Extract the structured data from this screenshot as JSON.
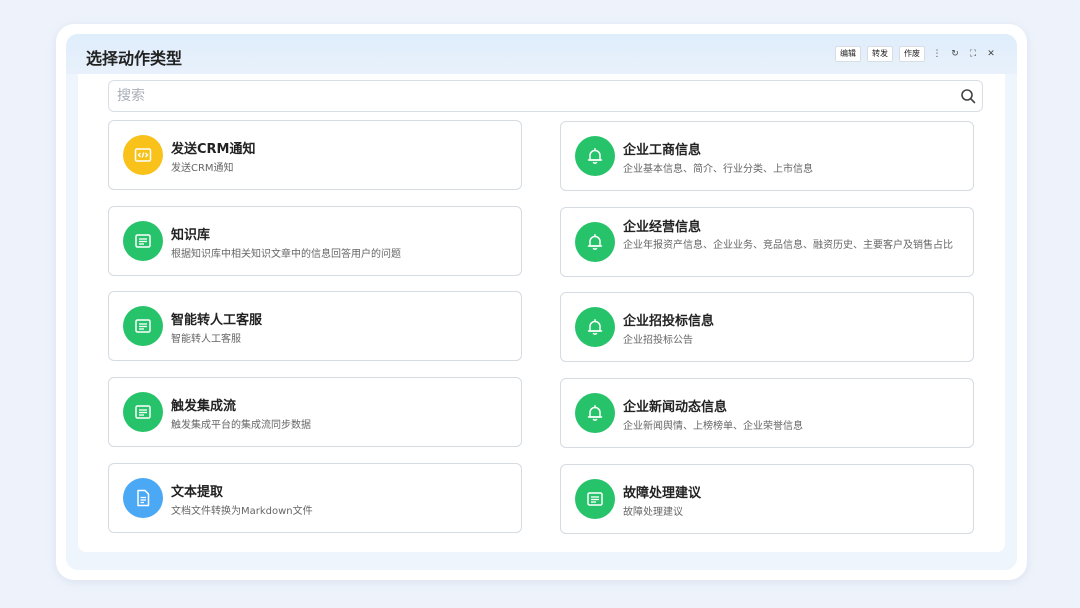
{
  "window": {
    "title": "选择动作类型",
    "actions": [
      "编辑",
      "转发",
      "作废"
    ],
    "controls": {
      "more": "⋮",
      "refresh": "↻",
      "maximize": "⛶",
      "close": "✕"
    }
  },
  "search": {
    "placeholder": "搜索",
    "value": ""
  },
  "colors": {
    "green": "#27c36a",
    "yellow": "#f8c21a",
    "blue": "#4aa8f5"
  },
  "cards_left": [
    {
      "title": "发送CRM通知",
      "desc": "发送CRM通知",
      "icon": "code-icon",
      "color": "#f8c21a"
    },
    {
      "title": "知识库",
      "desc": "根据知识库中相关知识文章中的信息回答用户的问题",
      "icon": "list-icon",
      "color": "#27c36a"
    },
    {
      "title": "智能转人工客服",
      "desc": "智能转人工客服",
      "icon": "list-icon",
      "color": "#27c36a"
    },
    {
      "title": "触发集成流",
      "desc": "触发集成平台的集成流同步数据",
      "icon": "list-icon",
      "color": "#27c36a"
    },
    {
      "title": "文本提取",
      "desc": "文档文件转换为Markdown文件",
      "icon": "document-icon",
      "color": "#4aa8f5"
    }
  ],
  "cards_right": [
    {
      "title": "企业工商信息",
      "desc": "企业基本信息、简介、行业分类、上市信息",
      "icon": "bell-icon",
      "color": "#27c36a"
    },
    {
      "title": "企业经营信息",
      "desc": "企业年报资产信息、企业业务、竞品信息、融资历史、主要客户及销售占比",
      "icon": "bell-icon",
      "color": "#27c36a"
    },
    {
      "title": "企业招投标信息",
      "desc": "企业招投标公告",
      "icon": "bell-icon",
      "color": "#27c36a"
    },
    {
      "title": "企业新闻动态信息",
      "desc": "企业新闻舆情、上榜榜单、企业荣誉信息",
      "icon": "bell-icon",
      "color": "#27c36a"
    },
    {
      "title": "故障处理建议",
      "desc": "故障处理建议",
      "icon": "list-icon",
      "color": "#27c36a"
    }
  ]
}
